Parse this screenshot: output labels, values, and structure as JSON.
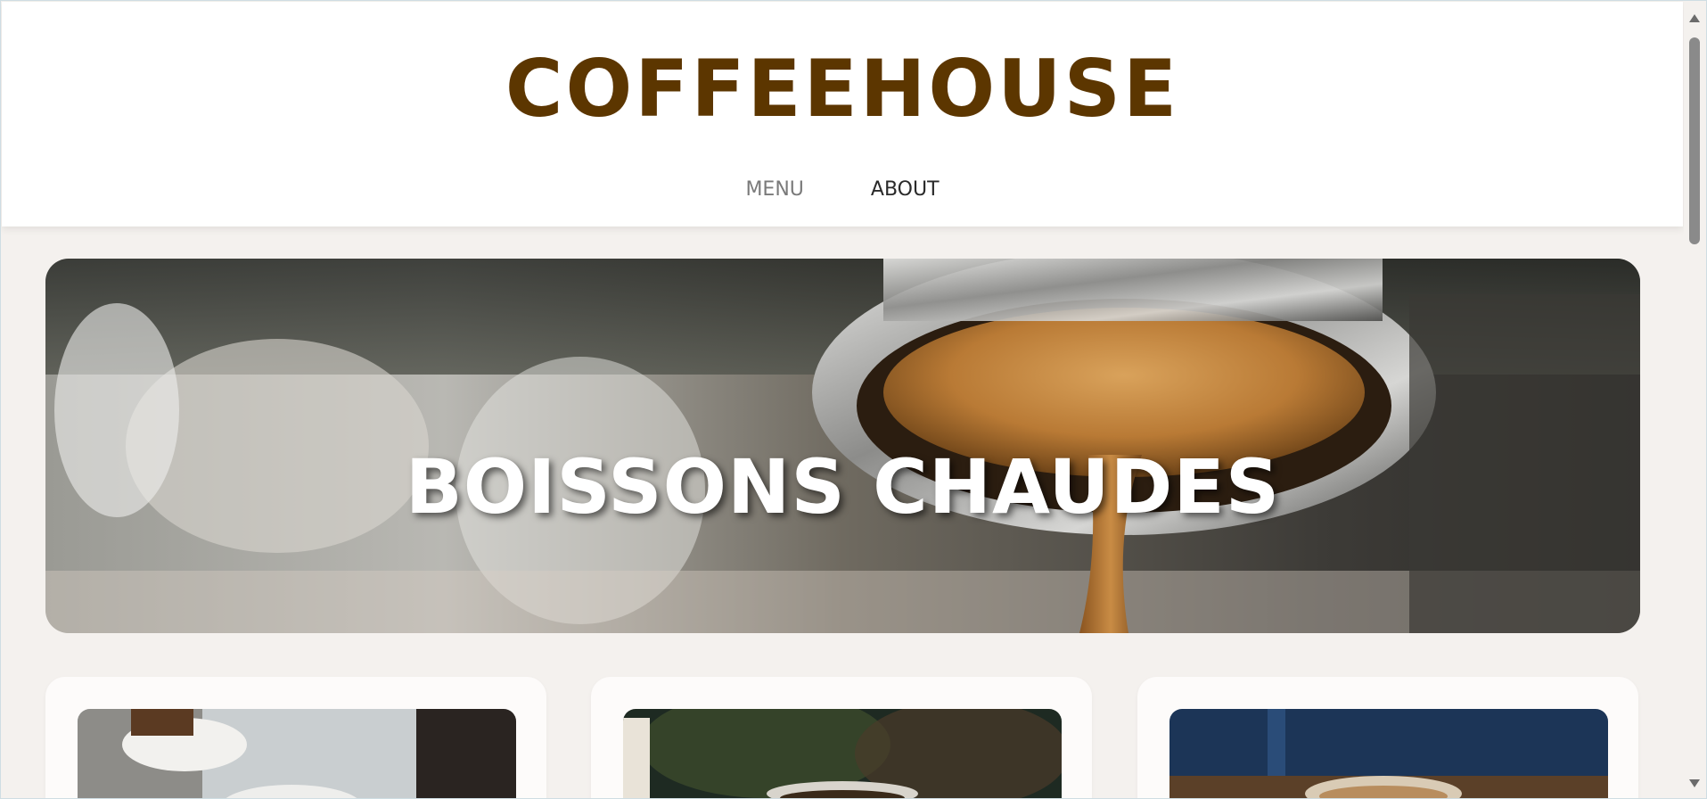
{
  "header": {
    "brand": "COFFEEHOUSE",
    "nav": [
      {
        "label": "MENU"
      },
      {
        "label": "ABOUT"
      }
    ]
  },
  "hero": {
    "title": "BOISSONS CHAUDES"
  },
  "cards": [
    {
      "image": "coffee-cup-photo"
    },
    {
      "image": "coffee-glass-photo"
    },
    {
      "image": "latte-photo"
    }
  ],
  "colors": {
    "brand": "#5c3600",
    "page_background": "#f4f1ee",
    "header_background": "#ffffff"
  }
}
